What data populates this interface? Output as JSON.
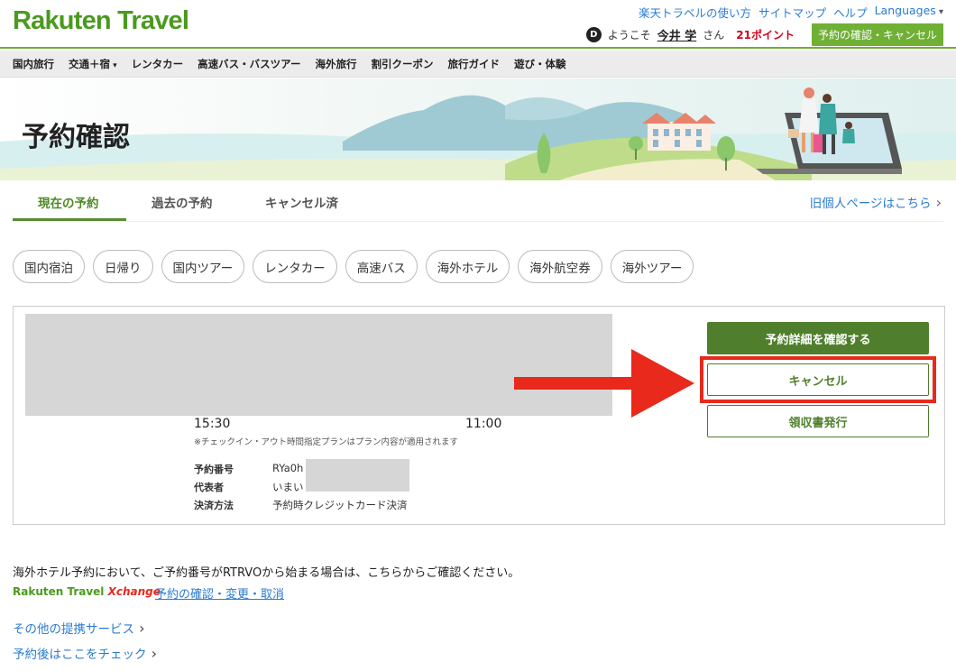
{
  "header": {
    "logo": "Rakuten Travel",
    "top_links": [
      "楽天トラベルの使い方",
      "サイトマップ",
      "ヘルプ",
      "Languages"
    ],
    "user_badge": "D",
    "greeting": "ようこそ",
    "user_name": "今井 学",
    "honorific": "さん",
    "points": "21ポイント",
    "confirm_button": "予約の確認・キャンセル"
  },
  "nav": [
    "国内旅行",
    "交通＋宿",
    "レンタカー",
    "高速バス・バスツアー",
    "海外旅行",
    "割引クーポン",
    "旅行ガイド",
    "遊び・体験"
  ],
  "hero": {
    "title": "予約確認"
  },
  "tabs": {
    "current": "現在の予約",
    "past": "過去の予約",
    "cancelled": "キャンセル済",
    "old_page": "旧個人ページはこちら"
  },
  "chips": [
    "国内宿泊",
    "日帰り",
    "国内ツアー",
    "レンタカー",
    "高速バス",
    "海外ホテル",
    "海外航空券",
    "海外ツアー"
  ],
  "reservation": {
    "checkin_time": "15:30",
    "checkout_time": "11:00",
    "note": "※チェックイン・アウト時間指定プランはプラン内容が適用されます",
    "labels": {
      "number": "予約番号",
      "representative": "代表者",
      "payment": "決済方法"
    },
    "values": {
      "number": "RYa0h",
      "representative": "いまい",
      "payment": "予約時クレジットカード決済"
    },
    "buttons": {
      "detail": "予約詳細を確認する",
      "cancel": "キャンセル",
      "receipt": "領収書発行"
    }
  },
  "footer": {
    "overseas_note": "海外ホテル予約において、ご予約番号がRTRVOから始まる場合は、こちらからご確認ください。",
    "rtx_logo_main": "Rakuten Travel ",
    "rtx_logo_x": "Xchange",
    "rtx_link": "予約の確認・変更・取消",
    "other_services": "その他の提携サービス",
    "after_booking": "予約後はここをチェック"
  },
  "colors": {
    "brand_green": "#4a9a1e",
    "button_green": "#4f7f2c",
    "highlight_red": "#e8291c",
    "link_blue": "#2a7bd0"
  }
}
